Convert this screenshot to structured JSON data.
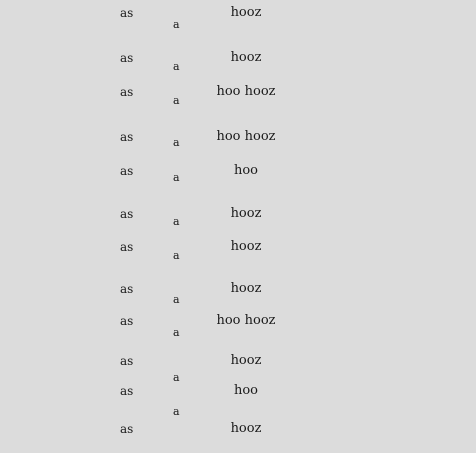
{
  "rows": [
    {
      "left": "as",
      "mid": "a",
      "right": "hooz"
    },
    {
      "left": "as",
      "mid": "a",
      "right": "hooz"
    },
    {
      "left": "as",
      "mid": "a",
      "right": "hoo hooz"
    },
    {
      "left": "as",
      "mid": "a",
      "right": "hoo hooz"
    },
    {
      "left": "as",
      "mid": "a",
      "right": "hoo"
    },
    {
      "left": "as",
      "mid": "a",
      "right": "hooz"
    },
    {
      "left": "as",
      "mid": "a",
      "right": "hooz"
    },
    {
      "left": "as",
      "mid": "a",
      "right": "hooz"
    },
    {
      "left": "as",
      "mid": "a",
      "right": "hoo hooz"
    },
    {
      "left": "as",
      "mid": "a",
      "right": "hooz"
    },
    {
      "left": "as",
      "mid": "a",
      "right": "hoo"
    },
    {
      "left": "as",
      "mid": "",
      "right": "hooz"
    }
  ]
}
